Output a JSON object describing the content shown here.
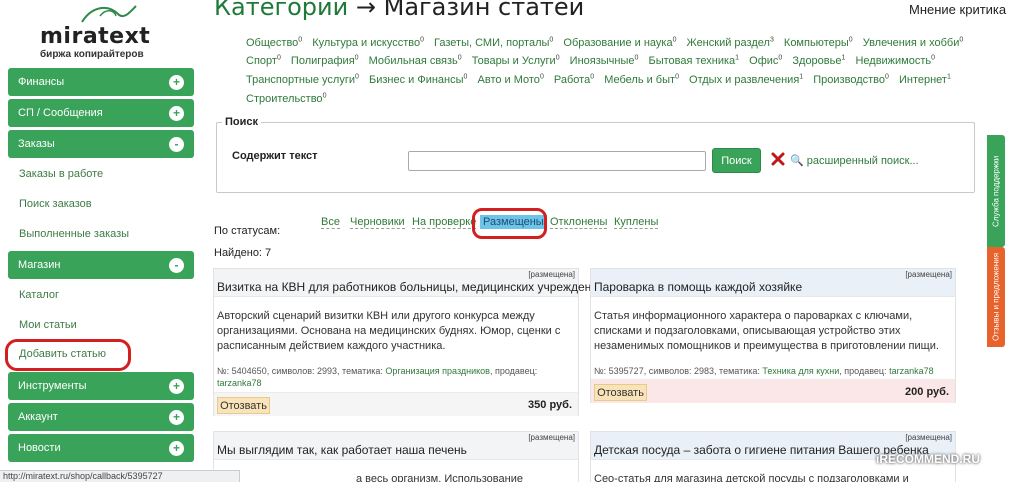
{
  "logo": {
    "name": "miratext",
    "tagline": "биржа копирайтеров"
  },
  "sidebar": {
    "sections": [
      {
        "label": "Финансы",
        "toggle": "+"
      },
      {
        "label": "СП / Сообщения",
        "toggle": "+"
      },
      {
        "label": "Заказы",
        "toggle": "-"
      },
      {
        "label": "Магазин",
        "toggle": "-"
      },
      {
        "label": "Инструменты",
        "toggle": "+"
      },
      {
        "label": "Аккаунт",
        "toggle": "+"
      },
      {
        "label": "Новости",
        "toggle": "+"
      }
    ],
    "orders_sub": [
      "Заказы в работе",
      "Поиск заказов",
      "Выполненные заказы"
    ],
    "shop_sub": [
      "Каталог",
      "Мои статьи",
      "Добавить статью"
    ]
  },
  "header": {
    "title_left": "Категории",
    "arrow": "→",
    "title_right": "Магазин статей",
    "top_right": "Мнение критика"
  },
  "categories": [
    {
      "name": "Общество",
      "count": "0"
    },
    {
      "name": "Культура и искусство",
      "count": "0"
    },
    {
      "name": "Газеты, СМИ, порталы",
      "count": "0"
    },
    {
      "name": "Образование и наука",
      "count": "0"
    },
    {
      "name": "Женский раздел",
      "count": "3"
    },
    {
      "name": "Компьютеры",
      "count": "0"
    },
    {
      "name": "Увлечения и хобби",
      "count": "0"
    },
    {
      "name": "Спорт",
      "count": "0"
    },
    {
      "name": "Полиграфия",
      "count": "0"
    },
    {
      "name": "Мобильная связь",
      "count": "0"
    },
    {
      "name": "Товары и Услуги",
      "count": "0"
    },
    {
      "name": "Иноязычные",
      "count": "0"
    },
    {
      "name": "Бытовая техника",
      "count": "1"
    },
    {
      "name": "Офис",
      "count": "0"
    },
    {
      "name": "Здоровье",
      "count": "1"
    },
    {
      "name": "Недвижимость",
      "count": "0"
    },
    {
      "name": "Транспортные услуги",
      "count": "0"
    },
    {
      "name": "Бизнес и Финансы",
      "count": "0"
    },
    {
      "name": "Авто и Мото",
      "count": "0"
    },
    {
      "name": "Работа",
      "count": "0"
    },
    {
      "name": "Мебель и быт",
      "count": "0"
    },
    {
      "name": "Отдых и развлечения",
      "count": "1"
    },
    {
      "name": "Производство",
      "count": "0"
    },
    {
      "name": "Интернет",
      "count": "1"
    },
    {
      "name": "Строительство",
      "count": "0"
    }
  ],
  "search": {
    "legend": "Поиск",
    "contains_label": "Содержит текст",
    "value": "",
    "button": "Поиск",
    "advanced": "расширенный поиск..."
  },
  "statuses": {
    "label": "По статусам:",
    "tabs": [
      "Все",
      "Черновики",
      "На проверке",
      "Размещены",
      "Отклонены",
      "Куплены"
    ],
    "active": "Размещены",
    "found": "Найдено: 7"
  },
  "cards": [
    {
      "badge": "[размещена]",
      "title": "Визитка на КВН для работников больницы, медицинских учреждений",
      "desc": "Авторский сценарий визитки КВН или другого конкурса между организациями. Основана на медицинских буднях. Юмор, сценки с расписанным действием каждого участника.",
      "meta_prefix": "№: 5404650, символов: 2993, тематика:",
      "topic": "Организация праздников",
      "seller_prefix": ", продавец:",
      "seller": "tarzanka78",
      "buy": "Отозвать",
      "price": "350 руб."
    },
    {
      "badge": "[размещена]",
      "title": "Пароварка в помощь каждой хозяйке",
      "desc": "Статья информационного характера о пароварках с ключами, списками и подзаголовками, описывающая устройство этих незаменимых помощников и преимущества в приготовлении пищи.",
      "meta_prefix": "№: 5395727, символов: 2983, тематика:",
      "topic": "Техника для кухни",
      "seller_prefix": ", продавец:",
      "seller": "tarzanka78",
      "buy": "Отозвать",
      "price": "200 руб."
    },
    {
      "badge": "[размещена]",
      "title": "Мы выглядим так, как работает наша печень",
      "desc": "а весь организм. Использование"
    },
    {
      "badge": "[размещена]",
      "title": "Детская посуда – забота о гигиене питания Вашего ребенка",
      "desc": "Сео-статья для магазина детской посуды с подзаголовками и списками"
    }
  ],
  "side_tabs": {
    "support": "Служба поддержки",
    "feedback": "Отзывы и предложения"
  },
  "statusbar": "http://miratext.ru/shop/callback/5395727",
  "watermark": "iRECOMMEND.RU"
}
